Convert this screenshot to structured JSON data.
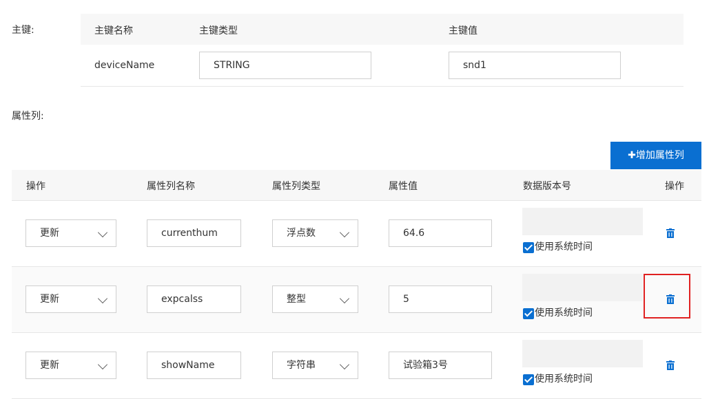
{
  "primary_key": {
    "label": "主键:",
    "headers": [
      "主键名称",
      "主键类型",
      "主键值"
    ],
    "row": {
      "name": "deviceName",
      "type": "STRING",
      "value": "snd1"
    }
  },
  "attributes": {
    "label": "属性列:",
    "add_button": "✚增加属性列",
    "headers": [
      "操作",
      "属性列名称",
      "属性列类型",
      "属性值",
      "数据版本号",
      "操作"
    ],
    "rows": [
      {
        "op": "更新",
        "name": "currenthum",
        "type": "浮点数",
        "value": "64.6",
        "use_sys_time": "使用系统时间"
      },
      {
        "op": "更新",
        "name": "expcalss",
        "type": "整型",
        "value": "5",
        "use_sys_time": "使用系统时间"
      },
      {
        "op": "更新",
        "name": "showName",
        "type": "字符串",
        "value": "试验箱3号",
        "use_sys_time": "使用系统时间"
      }
    ]
  },
  "colors": {
    "accent": "#0a6fd1",
    "highlight": "#e02020"
  }
}
